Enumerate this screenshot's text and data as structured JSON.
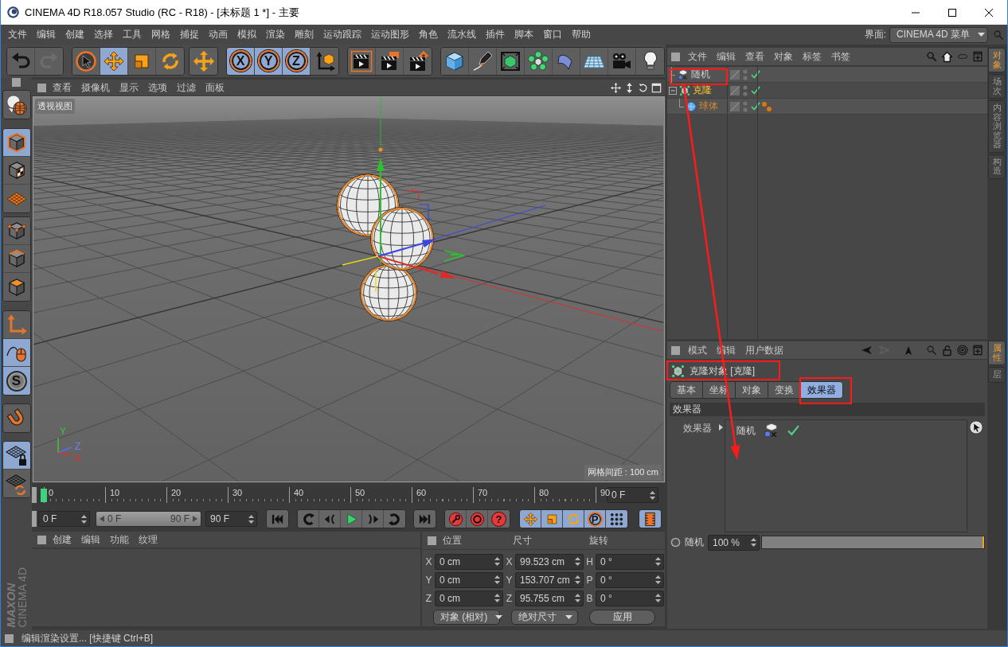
{
  "window": {
    "title": "CINEMA 4D R18.057 Studio (RC - R18) - [未标题 1 *] - 主要"
  },
  "menu_bar": {
    "items": [
      "文件",
      "编辑",
      "创建",
      "选择",
      "工具",
      "网格",
      "捕捉",
      "动画",
      "模拟",
      "渲染",
      "雕刻",
      "运动跟踪",
      "运动图形",
      "角色",
      "流水线",
      "插件",
      "脚本",
      "窗口",
      "帮助"
    ],
    "layout_label": "界面:",
    "layout_value": "CINEMA 4D 菜单"
  },
  "main_toolbar": {
    "groups": [
      [
        {
          "active": false,
          "disabled": false
        },
        {
          "active": false,
          "disabled": true
        }
      ],
      [
        {
          "active": false,
          "disabled": false
        },
        {
          "active": true,
          "disabled": false
        },
        {
          "active": false,
          "disabled": false
        },
        {
          "active": false,
          "disabled": false
        }
      ],
      [
        {
          "active": false,
          "disabled": false
        }
      ],
      [
        {
          "label": "X",
          "active": true,
          "disabled": false
        },
        {
          "label": "Y",
          "active": true,
          "disabled": false
        },
        {
          "label": "Z",
          "active": true,
          "disabled": false
        },
        {
          "active": false,
          "disabled": false
        }
      ],
      [
        {
          "active": false,
          "disabled": false
        },
        {
          "active": false,
          "disabled": false
        },
        {
          "active": false,
          "disabled": false
        }
      ],
      [
        {
          "active": false,
          "disabled": false
        },
        {
          "active": false,
          "disabled": false
        },
        {
          "active": false,
          "disabled": false
        },
        {
          "active": false,
          "disabled": false
        },
        {
          "active": false,
          "disabled": false
        },
        {
          "active": false,
          "disabled": false
        },
        {
          "active": false,
          "disabled": false
        },
        {
          "active": false,
          "disabled": false
        }
      ]
    ]
  },
  "tool_palette": {
    "groups": [
      [
        {
          "active": false
        }
      ],
      [
        {
          "active": true
        },
        {
          "active": false
        },
        {
          "active": false
        }
      ],
      [
        {
          "active": false
        },
        {
          "active": false
        },
        {
          "active": false
        }
      ],
      [
        {
          "active": false
        },
        {
          "active": true
        },
        {
          "label": "S",
          "active": true
        }
      ],
      [
        {
          "active": false
        }
      ],
      [
        {
          "active": true
        },
        {
          "active": false
        }
      ]
    ]
  },
  "viewport": {
    "menu": [
      "查看",
      "摄像机",
      "显示",
      "选项",
      "过滤",
      "面板"
    ],
    "view_name": "透视视图",
    "grid_spacing": "网格间距 : 100 cm",
    "axis_labels": [
      {
        "text": "Y",
        "color": "#3cc43c"
      },
      {
        "text": "Z",
        "color": "#7080ff"
      },
      {
        "text": "X",
        "color": "#e0302c"
      }
    ]
  },
  "timeline": {
    "ticks": [
      "0",
      "10",
      "20",
      "30",
      "40",
      "50",
      "60",
      "70",
      "80",
      "90"
    ],
    "level": 0,
    "current_frame": "0 F"
  },
  "transport": {
    "start": "0 F",
    "range": {
      "start": "0 F",
      "end": "90 F",
      "level": 1
    },
    "end": "90 F",
    "groups": [
      [
        {
          "active": false
        }
      ],
      [
        {
          "active": false
        },
        {
          "active": false
        },
        {
          "active": false
        },
        {
          "active": false
        },
        {
          "active": false
        }
      ],
      [
        {
          "active": false
        }
      ],
      [
        {
          "active": false
        },
        {
          "active": false
        },
        {
          "label": "?",
          "active": false
        }
      ],
      [
        {
          "active": true
        },
        {
          "active": true
        },
        {
          "active": true
        },
        {
          "label": "P",
          "active": true
        },
        {
          "active": true
        }
      ],
      [
        {
          "active": true
        }
      ]
    ]
  },
  "material_manager": {
    "menu": [
      "创建",
      "编辑",
      "功能",
      "纹理"
    ]
  },
  "coordinates": {
    "headers": [
      "位置",
      "尺寸",
      "旋转"
    ],
    "rows": [
      [
        {
          "axis": "X",
          "value": "0 cm"
        },
        {
          "axis": "X",
          "value": "99.523 cm"
        },
        {
          "axis": "H",
          "value": "0 °"
        }
      ],
      [
        {
          "axis": "Y",
          "value": "0 cm"
        },
        {
          "axis": "Y",
          "value": "153.707 cm"
        },
        {
          "axis": "P",
          "value": "0 °"
        }
      ],
      [
        {
          "axis": "Z",
          "value": "0 cm"
        },
        {
          "axis": "Z",
          "value": "95.755 cm"
        },
        {
          "axis": "B",
          "value": "0 °"
        }
      ]
    ],
    "mode_dropdown": "对象 (相对)",
    "size_dropdown": "绝对尺寸",
    "apply_button": "应用"
  },
  "logo": {
    "brand": "MAXON",
    "product": "CINEMA 4D"
  },
  "object_manager": {
    "menu": [
      "文件",
      "编辑",
      "查看",
      "对象",
      "标签",
      "书签"
    ],
    "objects": [
      {
        "name": "随机",
        "kind": "effector",
        "selected": false,
        "enabled": true
      },
      {
        "name": "克隆",
        "kind": "cloner",
        "selected": true,
        "expanded": true,
        "enabled": true,
        "children": [
          {
            "name": "球体",
            "kind": "sphere",
            "selected": false,
            "enabled": true,
            "tags": [
              {
                "kind": "phong"
              }
            ]
          }
        ]
      }
    ]
  },
  "side_tabs_top": [
    {
      "label": "对象",
      "selected": true
    },
    {
      "label": "场次",
      "selected": false
    },
    {
      "label": "内容浏览器",
      "selected": false
    },
    {
      "label": "构造",
      "selected": false
    }
  ],
  "attribute_manager": {
    "menu": [
      "模式",
      "编辑",
      "用户数据"
    ],
    "title": "克隆对象 [克隆]",
    "tabs": [
      {
        "label": "基本",
        "selected": false
      },
      {
        "label": "坐标",
        "selected": false
      },
      {
        "label": "对象",
        "selected": false
      },
      {
        "label": "变换",
        "selected": false
      },
      {
        "label": "效果器",
        "selected": true
      }
    ],
    "section": "效果器",
    "effectors_label": "效果器",
    "effectors": [
      {
        "name": "随机",
        "enabled": true
      }
    ],
    "strength": {
      "label": "随机",
      "value": "100 %",
      "level": 1
    }
  },
  "side_tabs_bottom": [
    {
      "label": "属性",
      "selected": true
    },
    {
      "label": "层",
      "selected": false
    }
  ],
  "status_bar": {
    "text": "编辑渲染设置... [快捷键 Ctrl+B]"
  },
  "annotations": [
    {
      "kind": "box"
    },
    {
      "kind": "box"
    },
    {
      "kind": "box"
    },
    {
      "kind": "arrow"
    }
  ]
}
